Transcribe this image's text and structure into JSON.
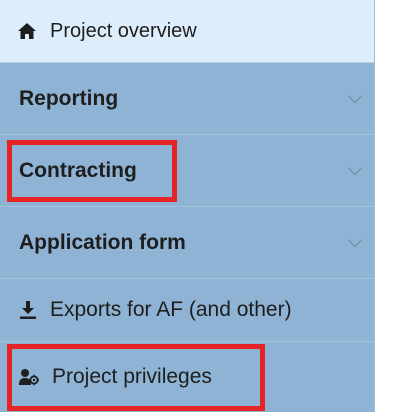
{
  "menu": {
    "overview": {
      "label": "Project overview",
      "icon": "home-icon"
    },
    "reporting": {
      "label": "Reporting",
      "icon": "chevron-down-icon"
    },
    "contracting": {
      "label": "Contracting",
      "icon": "chevron-down-icon",
      "highlighted": true
    },
    "application_form": {
      "label": "Application form",
      "icon": "chevron-down-icon"
    },
    "exports": {
      "label": "Exports for AF (and other)",
      "icon": "download-icon"
    },
    "privileges": {
      "label": "Project privileges",
      "icon": "users-gear-icon",
      "highlighted": true
    }
  },
  "colors": {
    "menu_background": "#8fb3d4",
    "active_background": "#deedfb",
    "highlight_border": "#e52427",
    "text": "#1e1e1e"
  }
}
